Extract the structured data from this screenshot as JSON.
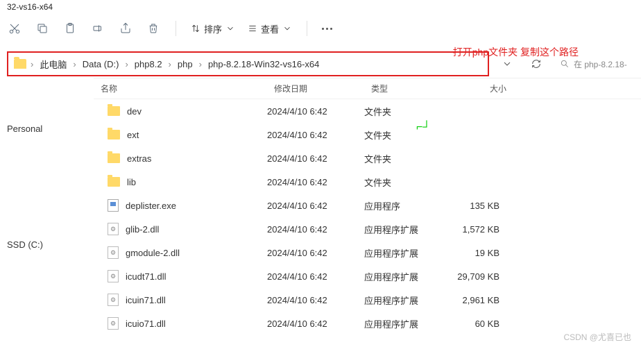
{
  "window": {
    "title_frag": "32-vs16-x64"
  },
  "toolbar": {
    "sort_label": "排序",
    "view_label": "查看"
  },
  "annotation": "打开php文件夹 复制这个路径",
  "breadcrumb": [
    "此电脑",
    "Data (D:)",
    "php8.2",
    "php",
    "php-8.2.18-Win32-vs16-x64"
  ],
  "search": {
    "placeholder": "在 php-8.2.18-"
  },
  "sidebar": {
    "item1": "Personal",
    "item2": "SSD (C:)"
  },
  "headers": {
    "name": "名称",
    "date": "修改日期",
    "type": "类型",
    "size": "大小"
  },
  "rows": [
    {
      "icon": "folder",
      "name": "dev",
      "date": "2024/4/10 6:42",
      "type": "文件夹",
      "size": ""
    },
    {
      "icon": "folder",
      "name": "ext",
      "date": "2024/4/10 6:42",
      "type": "文件夹",
      "size": ""
    },
    {
      "icon": "folder",
      "name": "extras",
      "date": "2024/4/10 6:42",
      "type": "文件夹",
      "size": ""
    },
    {
      "icon": "folder",
      "name": "lib",
      "date": "2024/4/10 6:42",
      "type": "文件夹",
      "size": ""
    },
    {
      "icon": "exe",
      "name": "deplister.exe",
      "date": "2024/4/10 6:42",
      "type": "应用程序",
      "size": "135 KB"
    },
    {
      "icon": "dll",
      "name": "glib-2.dll",
      "date": "2024/4/10 6:42",
      "type": "应用程序扩展",
      "size": "1,572 KB"
    },
    {
      "icon": "dll",
      "name": "gmodule-2.dll",
      "date": "2024/4/10 6:42",
      "type": "应用程序扩展",
      "size": "19 KB"
    },
    {
      "icon": "dll",
      "name": "icudt71.dll",
      "date": "2024/4/10 6:42",
      "type": "应用程序扩展",
      "size": "29,709 KB"
    },
    {
      "icon": "dll",
      "name": "icuin71.dll",
      "date": "2024/4/10 6:42",
      "type": "应用程序扩展",
      "size": "2,961 KB"
    },
    {
      "icon": "dll",
      "name": "icuio71.dll",
      "date": "2024/4/10 6:42",
      "type": "应用程序扩展",
      "size": "60 KB"
    }
  ],
  "watermark": "CSDN @尤喜已也"
}
